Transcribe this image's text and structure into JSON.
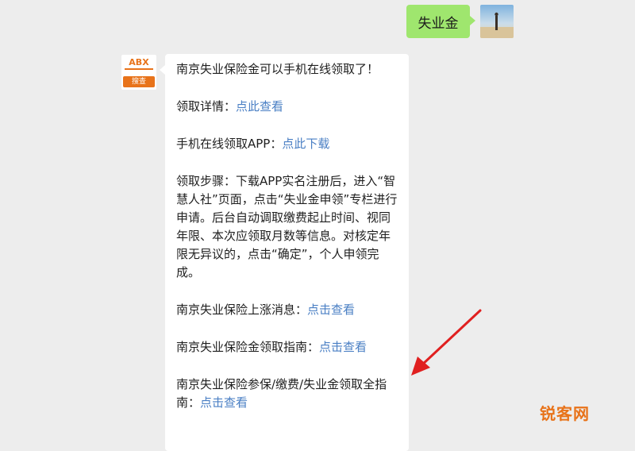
{
  "outgoing": {
    "text": "失业金"
  },
  "incoming": {
    "line1": "南京失业保险金可以手机在线领取了！",
    "line2_label": "领取详情：",
    "line2_link": "点此查看",
    "line3_label": "手机在线领取APP：",
    "line3_link": "点此下载",
    "steps": "领取步骤：下载APP实名注册后，进入“智慧人社”页面，点击“失业金申领”专栏进行申请。后台自动调取缴费起止时间、视同年限、本次应领取月数等信息。对核定年限无异议的，点击“确定”，个人申领完成。",
    "line5_label": "南京失业保险上涨消息：",
    "line5_link": "点击查看",
    "line6_label": "南京失业保险金领取指南：",
    "line6_link": "点击查看",
    "line7_label": "南京失业保险参保/缴费/失业金领取全指南：",
    "line7_link": "点击查看"
  },
  "bot_avatar": {
    "logo_top": "ABX",
    "logo_bottom": "搜查"
  },
  "watermark": "锐客网",
  "colors": {
    "background": "#ededed",
    "outgoing_bubble": "#9fe66e",
    "incoming_bubble": "#ffffff",
    "link": "#4a7fc4",
    "arrow": "#e02020",
    "brand_orange": "#e8731a"
  }
}
